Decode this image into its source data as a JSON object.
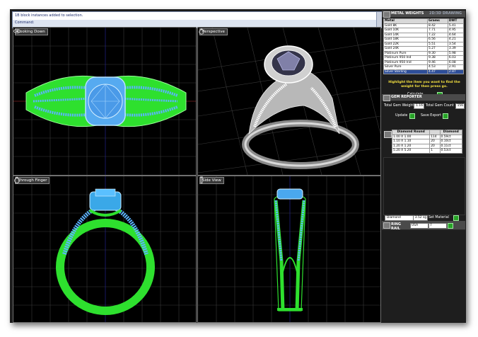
{
  "command_line": {
    "message": "1B block instances added to selection.",
    "prompt": "Command:"
  },
  "viewports": {
    "top": {
      "title": "Looking Down",
      "icon": "top-view-icon"
    },
    "perspective": {
      "title": "Perspective",
      "icon": "perspective-view-icon"
    },
    "front": {
      "title": "Through Finger",
      "icon": "front-view-icon"
    },
    "side": {
      "title": "Side View",
      "icon": "side-view-icon"
    }
  },
  "panel": {
    "metal_tab": "METAL WEIGHTS",
    "other_tab": "2D/3D DRAWING",
    "metal_table": {
      "headers": [
        "Metal",
        "Grams",
        "DWT"
      ],
      "rows": [
        [
          "Gold 8K",
          "8.42",
          "5.41"
        ],
        [
          "Gold 10K",
          "7.71",
          "4.95"
        ],
        [
          "Gold 14K",
          "7.22",
          "4.64"
        ],
        [
          "Gold 18K",
          "6.56",
          "4.21"
        ],
        [
          "Gold 22K",
          "5.51",
          "3.54"
        ],
        [
          "Gold 24K",
          "5.27",
          "3.39"
        ],
        [
          "Platinum Pure",
          "9.30",
          "5.98"
        ],
        [
          "Platinum 950 Ind",
          "9.38",
          "6.03"
        ],
        [
          "Platinum 950 Irid",
          "9.46",
          "6.08"
        ],
        [
          "Silver Pure",
          "4.53",
          "2.91"
        ],
        [
          "Silver Sterling",
          "4.47",
          "2.87"
        ]
      ],
      "selected_row": 10
    },
    "hint": "Highlight the item you want to find the weight for then press go.",
    "calculate_label": "Calculate",
    "gem_tab": "GEM REPORTER",
    "total_gem_weight_label": "Total Gem Weight",
    "total_gem_weight_value": "1.16",
    "total_gem_count_label": "Total Gem Count",
    "total_gem_count_value": "156",
    "update_label": "Update",
    "save_export_label": "Save Export",
    "gem_table": {
      "headers": [
        "Diamond Round",
        "",
        "Diamond"
      ],
      "rows": [
        [
          "1.00 X 1.00",
          "114",
          "0.59ct"
        ],
        [
          "1.10 X 1.10",
          "20",
          "0.10ct"
        ],
        [
          "1.20 X 1.20",
          "20",
          "0.11ct"
        ],
        [
          "5.20 X 5.20",
          "1",
          "0.53ct"
        ]
      ]
    },
    "material_value": "Diamond",
    "material_sg": "3.52 sg",
    "set_material_label": "Set Material",
    "ring_rail_label": "RING RAIL",
    "ring_country": "USA",
    "ring_size": "7"
  }
}
